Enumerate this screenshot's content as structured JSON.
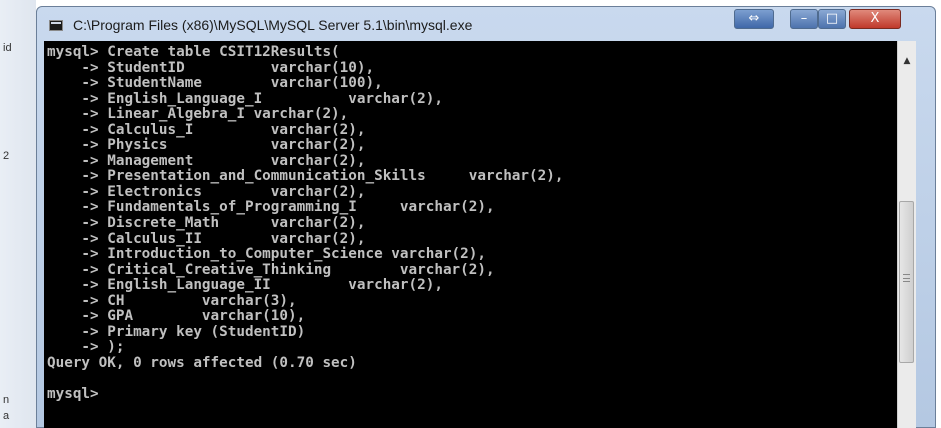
{
  "window": {
    "title": "C:\\Program Files (x86)\\MySQL\\MySQL Server 5.1\\bin\\mysql.exe",
    "buttons": {
      "restore": "⇔",
      "minimize": "–",
      "maximize": "□",
      "close": "X"
    }
  },
  "left_strip": {
    "glyphs": [
      "id",
      "2",
      "n",
      "a"
    ]
  },
  "console": {
    "lines": [
      "mysql> Create table CSIT12Results(",
      "    -> StudentID          varchar(10),",
      "    -> StudentName        varchar(100),",
      "    -> English_Language_I          varchar(2),",
      "    -> Linear_Algebra_I varchar(2),",
      "    -> Calculus_I         varchar(2),",
      "    -> Physics            varchar(2),",
      "    -> Management         varchar(2),",
      "    -> Presentation_and_Communication_Skills     varchar(2),",
      "    -> Electronics        varchar(2),",
      "    -> Fundamentals_of_Programming_I     varchar(2),",
      "    -> Discrete_Math      varchar(2),",
      "    -> Calculus_II        varchar(2),",
      "    -> Introduction_to_Computer_Science varchar(2),",
      "    -> Critical_Creative_Thinking        varchar(2),",
      "    -> English_Language_II         varchar(2),",
      "    -> CH         varchar(3),",
      "    -> GPA        varchar(10),",
      "    -> Primary key (StudentID)",
      "    -> );",
      "Query OK, 0 rows affected (0.70 sec)",
      "",
      "mysql>"
    ]
  },
  "scrollbar": {
    "up_arrow": "▲",
    "position_fraction": 0.72
  }
}
